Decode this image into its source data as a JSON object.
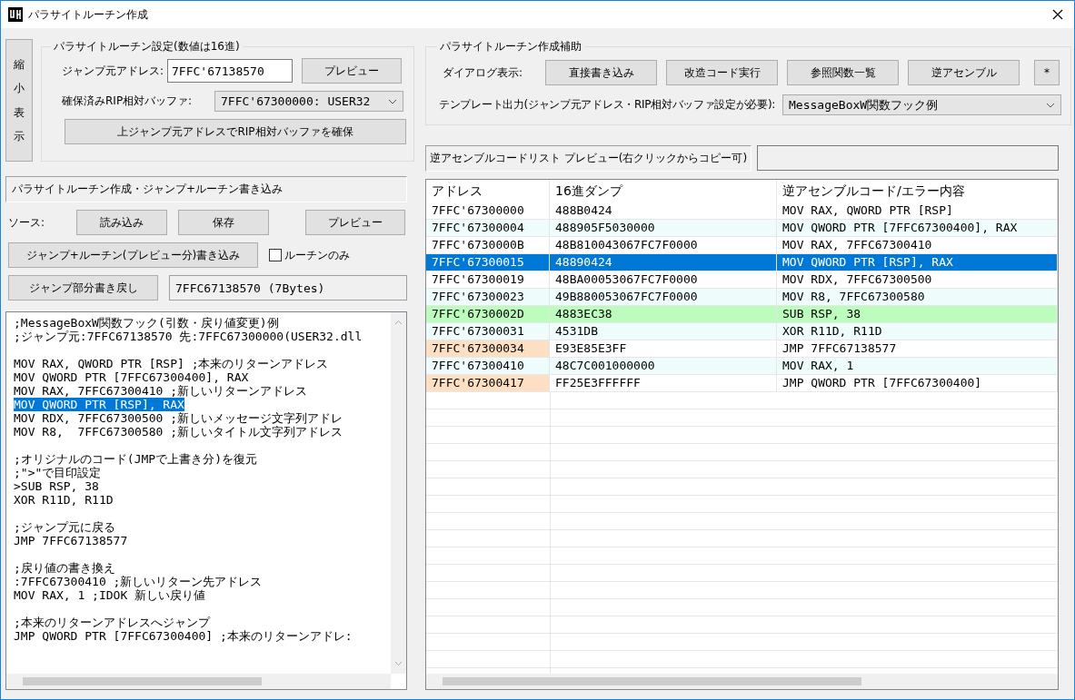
{
  "window": {
    "title": "パラサイトルーチン作成"
  },
  "shrink_button": "縮小表示",
  "settings": {
    "legend": "パラサイトルーチン設定(数値は16進)",
    "jump_label": "ジャンプ元アドレス:",
    "jump_value": "7FFC'67138570",
    "preview_button": "プレビュー",
    "buffer_label": "確保済みRIP相対バッファ:",
    "buffer_value": "7FFC'67300000: USER32",
    "reserve_button": "上ジャンプ元アドレスでRIP相対バッファを確保"
  },
  "assist": {
    "legend": "パラサイトルーチン作成補助",
    "dialog_label": "ダイアログ表示:",
    "buttons": [
      "直接書き込み",
      "改造コード実行",
      "参照関数一覧",
      "逆アセンブル",
      "*"
    ],
    "template_label": "テンプレート出力(ジャンプ元アドレス・RIP相対バッファ設定が必要):",
    "template_value": "MessageBoxW関数フック例"
  },
  "section_title": "パラサイトルーチン作成・ジャンプ+ルーチン書き込み",
  "source": {
    "label": "ソース:",
    "buttons": [
      "読み込み",
      "保存",
      "プレビュー"
    ]
  },
  "write_button": "ジャンプ+ルーチン(プレビュー分)書き込み",
  "routine_only": {
    "label": "ルーチンのみ",
    "checked": false
  },
  "restore_button": "ジャンプ部分書き戻し",
  "restore_info": "7FFC67138570 (7Bytes)",
  "editor": {
    "blocks": [
      [
        {
          "text": ";MessageBoxW関数フック(引数・戻り値変更)例",
          "selected": false
        },
        {
          "text": ";ジャンプ元:7FFC67138570 先:7FFC67300000(USER32.dll",
          "selected": false
        }
      ],
      [
        {
          "text": "MOV RAX, QWORD PTR [RSP] ;本来のリターンアドレス",
          "selected": false
        },
        {
          "text": "MOV QWORD PTR [7FFC67300400], RAX",
          "selected": false
        },
        {
          "text": "MOV RAX, 7FFC67300410 ;新しいリターンアドレス",
          "selected": false
        },
        {
          "text": "MOV QWORD PTR [RSP], RAX",
          "selected": true
        },
        {
          "text": "MOV RDX, 7FFC67300500 ;新しいメッセージ文字列アドレ",
          "selected": false
        },
        {
          "text": "MOV R8,  7FFC67300580 ;新しいタイトル文字列アドレス",
          "selected": false
        }
      ],
      [
        {
          "text": ";オリジナルのコード(JMPで上書き分)を復元",
          "selected": false
        },
        {
          "text": ";\">\"で目印設定",
          "selected": false
        },
        {
          "text": ">SUB RSP, 38",
          "selected": false
        },
        {
          "text": "XOR R11D, R11D",
          "selected": false
        }
      ],
      [
        {
          "text": ";ジャンプ元に戻る",
          "selected": false
        },
        {
          "text": "JMP 7FFC67138577",
          "selected": false
        }
      ],
      [
        {
          "text": ";戻り値の書き換え",
          "selected": false
        },
        {
          "text": ":7FFC67300410 ;新しいリターン先アドレス",
          "selected": false
        },
        {
          "text": "MOV RAX, 1 ;IDOK 新しい戻り値",
          "selected": false
        }
      ],
      [
        {
          "text": ";本来のリターンアドレスへジャンプ",
          "selected": false
        },
        {
          "text": "JMP QWORD PTR [7FFC67300400] ;本来のリターンアドレ:",
          "selected": false
        }
      ]
    ]
  },
  "list_title": "逆アセンブルコードリスト プレビュー(右クリックからコピー可)",
  "table": {
    "columns": [
      "アドレス",
      "16進ダンプ",
      "逆アセンブルコード/エラー内容"
    ],
    "rows": [
      {
        "address": "7FFC'67300000",
        "dump": "488B0424",
        "code": "MOV RAX, QWORD PTR [RSP]",
        "selected": false,
        "kind": "plain"
      },
      {
        "address": "7FFC'67300004",
        "dump": "488905F5030000",
        "code": "MOV QWORD PTR [7FFC67300400], RAX",
        "selected": false,
        "kind": "plain"
      },
      {
        "address": "7FFC'6730000B",
        "dump": "48B810043067FC7F0000",
        "code": "MOV RAX, 7FFC67300410",
        "selected": false,
        "kind": "plain"
      },
      {
        "address": "7FFC'67300015",
        "dump": "48890424",
        "code": "MOV QWORD PTR [RSP], RAX",
        "selected": true,
        "kind": "plain"
      },
      {
        "address": "7FFC'67300019",
        "dump": "48BA00053067FC7F0000",
        "code": "MOV RDX, 7FFC67300500",
        "selected": false,
        "kind": "plain"
      },
      {
        "address": "7FFC'67300023",
        "dump": "49B880053067FC7F0000",
        "code": "MOV R8,  7FFC67300580",
        "selected": false,
        "kind": "plain"
      },
      {
        "address": "7FFC'6730002D",
        "dump": "4883EC38",
        "code": "SUB RSP, 38",
        "selected": false,
        "kind": "marked"
      },
      {
        "address": "7FFC'67300031",
        "dump": "4531DB",
        "code": "XOR R11D, R11D",
        "selected": false,
        "kind": "plain"
      },
      {
        "address": "7FFC'67300034",
        "dump": "E93E85E3FF",
        "code": "JMP 7FFC67138577",
        "selected": false,
        "kind": "jump"
      },
      {
        "address": "7FFC'67300410",
        "dump": "48C7C001000000",
        "code": "MOV RAX, 1",
        "selected": false,
        "kind": "plain"
      },
      {
        "address": "7FFC'67300417",
        "dump": "FF25E3FFFFFF",
        "code": "JMP QWORD PTR [7FFC67300400]",
        "selected": false,
        "kind": "jump"
      }
    ]
  }
}
